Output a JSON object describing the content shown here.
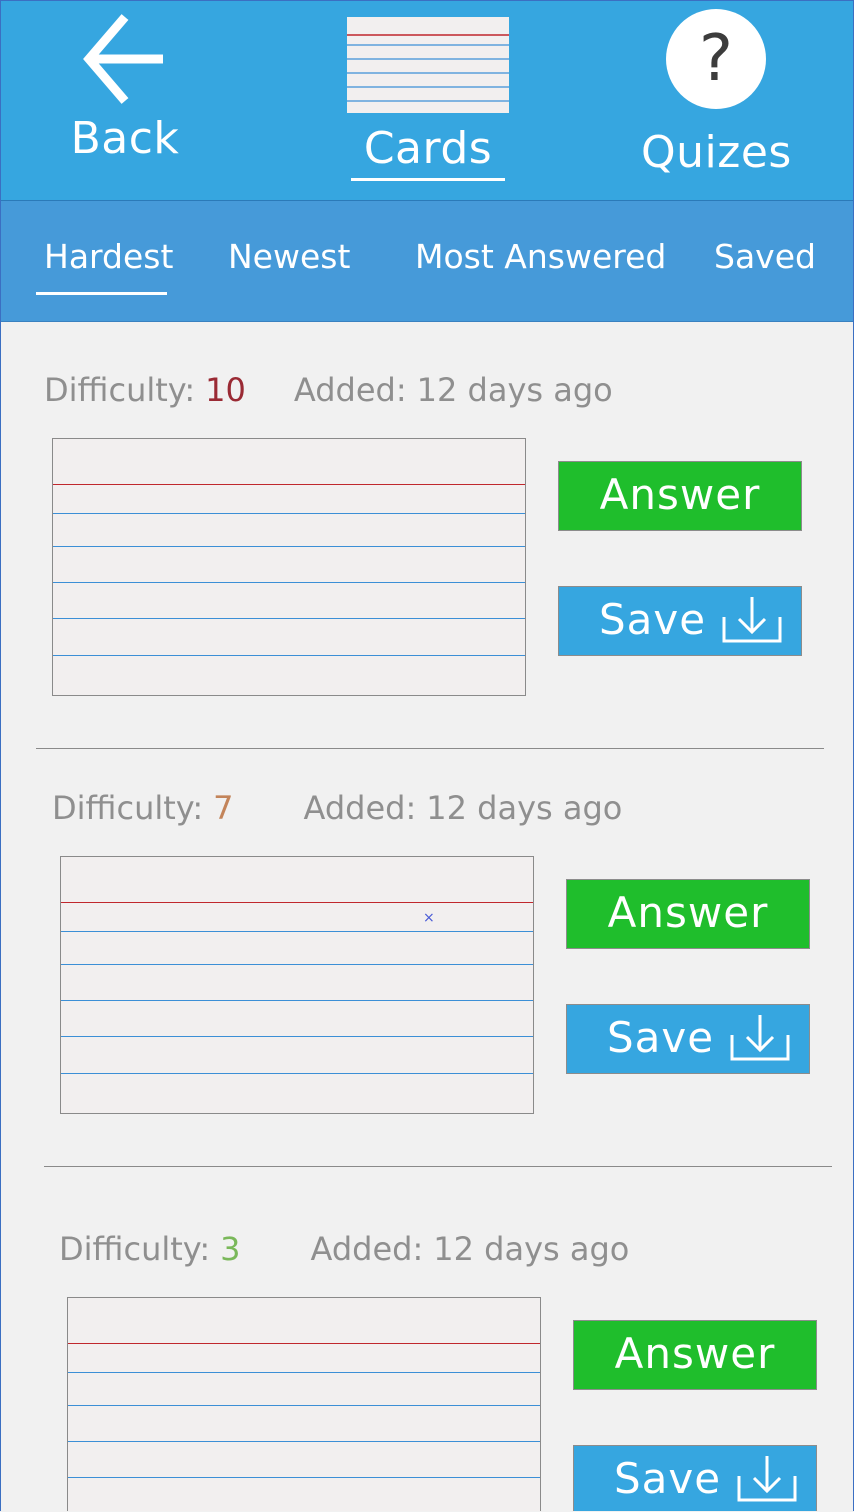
{
  "topbar": {
    "back_label": "Back",
    "cards_label": "Cards",
    "quizzes_label": "Quizes",
    "quiz_icon_glyph": "?"
  },
  "tabs": [
    {
      "label": "Hardest",
      "active": true
    },
    {
      "label": "Newest",
      "active": false
    },
    {
      "label": "Most Answered",
      "active": false
    },
    {
      "label": "Saved",
      "active": false
    }
  ],
  "cards": [
    {
      "difficulty_label": "Difficulty:",
      "difficulty": "10",
      "difficulty_color": "#9a2a34",
      "added_label": "Added:",
      "added": "12 days ago",
      "answer_label": "Answer",
      "save_label": "Save"
    },
    {
      "difficulty_label": "Difficulty:",
      "difficulty": "7",
      "difficulty_color": "#c3845a",
      "added_label": "Added:",
      "added": "12 days ago",
      "answer_label": "Answer",
      "save_label": "Save"
    },
    {
      "difficulty_label": "Difficulty:",
      "difficulty": "3",
      "difficulty_color": "#7ab85a",
      "added_label": "Added:",
      "added": "12 days ago",
      "answer_label": "Answer",
      "save_label": "Save"
    }
  ],
  "colors": {
    "topbar_bg": "#36a6e0",
    "tabbar_bg": "#469ad9",
    "answer_green": "#1fbe2c",
    "save_blue": "#36a6e0"
  },
  "icons": {
    "back": "arrow-left-icon",
    "cards": "index-card-icon",
    "quizzes": "question-circle-icon",
    "save": "download-tray-icon"
  }
}
